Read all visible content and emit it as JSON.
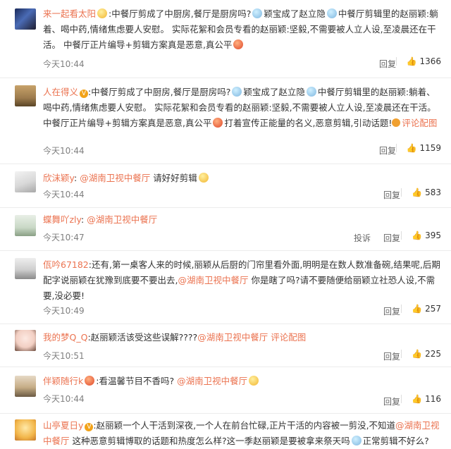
{
  "comments": [
    {
      "user": "来一起看太阳",
      "segments": [
        ":中餐厅剪成了中厨房,餐厅是厨房吗?",
        "颖宝成了赵立隐",
        "中餐厅剪辑里的赵丽颖:躺着、喝中药,情绪焦虑要人安慰。 实际花絮和会员专看的赵丽颖:坚毅,不需要被人立人设,至凌晨还在干活。 中餐厅正片编导+剪辑方案真是恶意,真公平"
      ],
      "time": "今天10:44",
      "reply": "回复",
      "likes": "1366"
    },
    {
      "user": "人在得义",
      "segments": [
        ":中餐厅剪成了中厨房,餐厅是厨房吗?",
        "颖宝成了赵立隐",
        "中餐厅剪辑里的赵丽颖:躺着、喝中药,情绪焦虑要人安慰。 实际花絮和会员专看的赵丽颖:坚毅,不需要被人立人设,至凌晨还在干活。 中餐厅正片编导+剪辑方案真是恶意,真公平",
        "打着宣传正能量的名义,恶意剪辑,引动话题!"
      ],
      "link": "评论配图",
      "time": "今天10:44",
      "reply": "回复",
      "likes": "1159"
    },
    {
      "user": "欣沫颖y",
      "mention": "@湖南卫视中餐厅",
      "text": "请好好剪辑",
      "time": "今天10:44",
      "reply": "回复",
      "likes": "583"
    },
    {
      "user": "蝶舞吖zly",
      "mention": "@湖南卫视中餐厅",
      "time": "今天10:47",
      "report": "投诉",
      "reply": "回复",
      "likes": "395"
    },
    {
      "user": "佤吟67182",
      "text": ":还有,第一桌客人来的时候,丽颖从后厨的门帘里看外面,明明是在数人数准备碗,结果呢,后期配字说丽颖在犹豫到底要不要出去,",
      "mention": "@湖南卫视中餐厅",
      "text2": "你是瞎了吗?请不要随便给丽颖立社恐人设,不需要,没必要!",
      "time": "今天10:49",
      "reply": "回复",
      "likes": "257"
    },
    {
      "user": "我的梦Q_Q",
      "text": ":赵丽颖活该受这些误解????",
      "mention": "@湖南卫视中餐厅",
      "link": "评论配图",
      "time": "今天10:51",
      "reply": "回复",
      "likes": "225"
    },
    {
      "user": "伴颖随行k",
      "text": ":看温馨节目不香吗?",
      "mention": "@湖南卫视中餐厅",
      "time": "今天10:44",
      "reply": "回复",
      "likes": "116"
    },
    {
      "user": "山亭夏日y",
      "text": ":赵丽颖一个人干活到深夜,一个人在前台忙碌,正片干活的内容被一剪没,不知道",
      "mention": "@湖南卫视中餐厅",
      "text2": "这种恶意剪辑博取的话题和热度怎么样?这一季赵丽颖是要被拿来祭天吗",
      "text3": "正常剪辑不好么?",
      "mention_prefix": "@湖南卫视中餐厅"
    }
  ]
}
